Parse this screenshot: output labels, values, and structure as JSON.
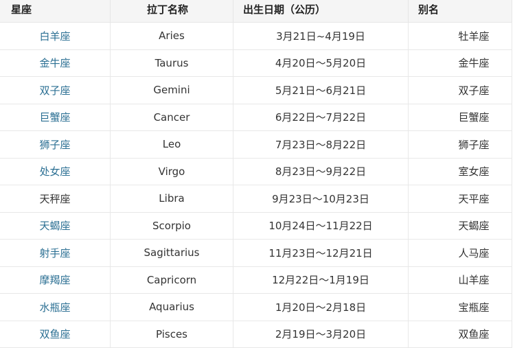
{
  "table": {
    "headers": [
      "星座",
      "拉丁名称",
      "出生日期（公历）",
      "别名"
    ],
    "rows": [
      {
        "name": "白羊座",
        "latin": "Aries",
        "dates": "3月21日~4月19日",
        "alias": "牡羊座",
        "linked": true
      },
      {
        "name": "金牛座",
        "latin": "Taurus",
        "dates": "4月20日～5月20日",
        "alias": "金牛座",
        "linked": true
      },
      {
        "name": "双子座",
        "latin": "Gemini",
        "dates": "5月21日～6月21日",
        "alias": "双子座",
        "linked": true
      },
      {
        "name": "巨蟹座",
        "latin": "Cancer",
        "dates": "6月22日～7月22日",
        "alias": "巨蟹座",
        "linked": true
      },
      {
        "name": "狮子座",
        "latin": "Leo",
        "dates": "7月23日～8月22日",
        "alias": "狮子座",
        "linked": true
      },
      {
        "name": "处女座",
        "latin": "Virgo",
        "dates": "8月23日～9月22日",
        "alias": "室女座",
        "linked": true
      },
      {
        "name": "天秤座",
        "latin": "Libra",
        "dates": "9月23日～10月23日",
        "alias": "天平座",
        "linked": false
      },
      {
        "name": "天蝎座",
        "latin": "Scorpio",
        "dates": "10月24日～11月22日",
        "alias": "天蝎座",
        "linked": true
      },
      {
        "name": "射手座",
        "latin": "Sagittarius",
        "dates": "11月23日～12月21日",
        "alias": "人马座",
        "linked": true
      },
      {
        "name": "摩羯座",
        "latin": "Capricorn",
        "dates": "12月22日～1月19日",
        "alias": "山羊座",
        "linked": true
      },
      {
        "name": "水瓶座",
        "latin": "Aquarius",
        "dates": "1月20日～2月18日",
        "alias": "宝瓶座",
        "linked": true
      },
      {
        "name": "双鱼座",
        "latin": "Pisces",
        "dates": "2月19日～3月20日",
        "alias": "双鱼座",
        "linked": true
      }
    ]
  },
  "colors": {
    "link": "#2b6f93",
    "text": "#333333",
    "header_bg": "#f5f5f5"
  }
}
